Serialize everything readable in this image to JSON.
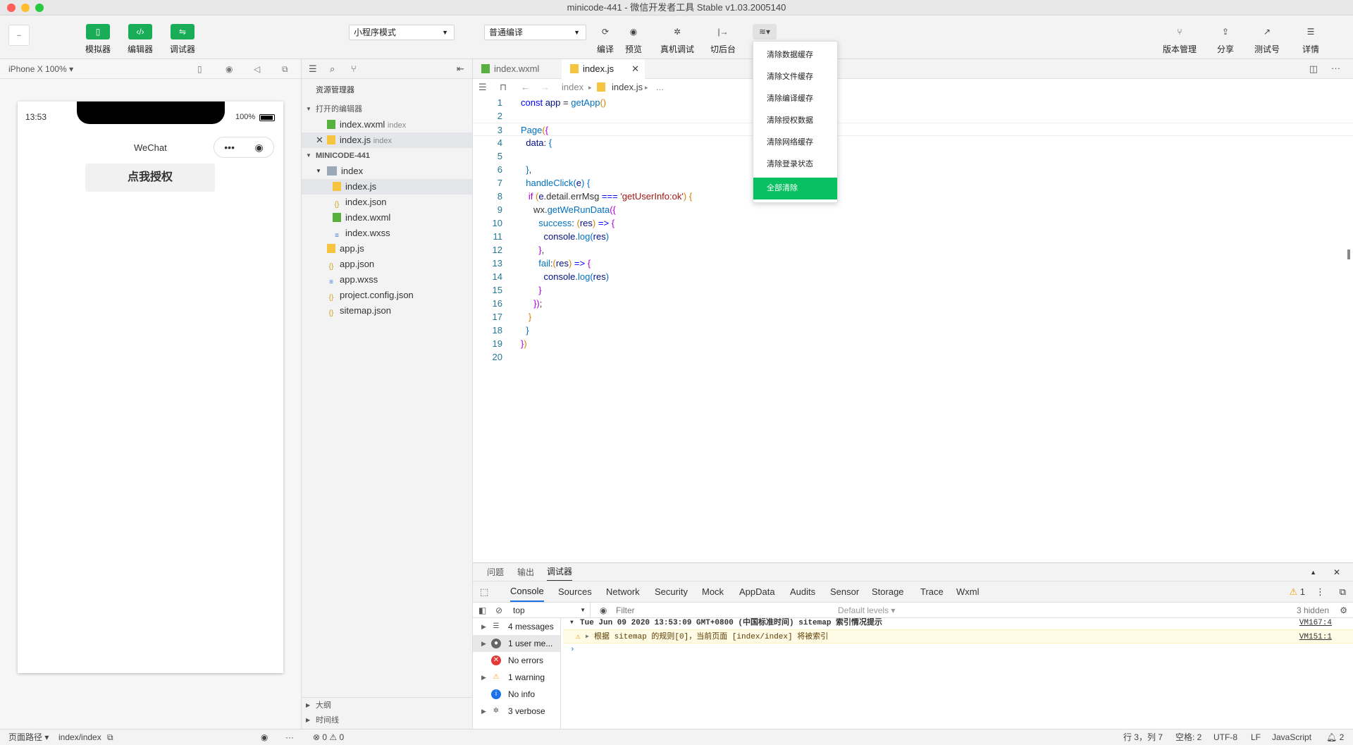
{
  "window": {
    "title": "minicode-441 - 微信开发者工具 Stable v1.03.2005140"
  },
  "toolbar": {
    "simulator": "模拟器",
    "editor": "编辑器",
    "debugger": "调试器",
    "mode_select": "小程序模式",
    "compile_select": "普通编译",
    "compile": "编译",
    "preview": "预览",
    "real_debug": "真机调试",
    "background": "切后台",
    "version": "版本管理",
    "share": "分享",
    "test_account": "测试号",
    "details": "详情"
  },
  "simulator": {
    "device": "iPhone X 100% ▾",
    "time": "13:53",
    "battery": "100%",
    "nav_title": "WeChat",
    "button_label": "点我授权"
  },
  "explorer": {
    "title": "资源管理器",
    "open_editors": "打开的编辑器",
    "open_files": [
      {
        "name": "index.wxml",
        "hint": "index"
      },
      {
        "name": "index.js",
        "hint": "index"
      }
    ],
    "project": "MINICODE-441",
    "tree": [
      "index",
      "index.js",
      "index.json",
      "index.wxml",
      "index.wxss",
      "app.js",
      "app.json",
      "app.wxss",
      "project.config.json",
      "sitemap.json"
    ],
    "outline": "大纲",
    "timeline": "时间线"
  },
  "editor": {
    "tabs": [
      "index.wxml",
      "index.js"
    ],
    "breadcrumb": [
      "index",
      "index.js",
      "..."
    ],
    "lines": [
      "1",
      "2",
      "3",
      "4",
      "5",
      "6",
      "7",
      "8",
      "9",
      "10",
      "11",
      "12",
      "13",
      "14",
      "15",
      "16",
      "17",
      "18",
      "19",
      "20"
    ]
  },
  "dropdown": {
    "items": [
      "清除数据缓存",
      "清除文件缓存",
      "清除编译缓存",
      "清除授权数据",
      "清除网络缓存",
      "清除登录状态"
    ],
    "primary": "全部清除"
  },
  "devtools": {
    "panels": [
      "问题",
      "输出",
      "调试器"
    ],
    "tabs": [
      "Console",
      "Sources",
      "Network",
      "Security",
      "Mock",
      "AppData",
      "Audits",
      "Sensor",
      "Storage",
      "Trace",
      "Wxml"
    ],
    "warn_count": "1",
    "context": "top",
    "filter_placeholder": "Filter",
    "levels": "Default levels ▾",
    "hidden": "3 hidden",
    "sidebar": [
      "4 messages",
      "1 user me...",
      "No errors",
      "1 warning",
      "No info",
      "3 verbose"
    ],
    "log1": "Tue Jun 09 2020 13:53:09 GMT+0800 (中国标准时间) sitemap 索引情况提示",
    "log1_src": "VM167:4",
    "log2": "根据 sitemap 的规则[0]，当前页面 [index/index] 将被索引",
    "log2_src": "VM151:1"
  },
  "statusbar": {
    "page_path_label": "页面路径 ▾",
    "page_path": "index/index",
    "errors": "0",
    "warnings": "0",
    "position": "行 3，列 7",
    "spaces": "空格: 2",
    "encoding": "UTF-8",
    "eol": "LF",
    "language": "JavaScript",
    "notifications": "2"
  },
  "colors": {
    "accent": "#1aad57",
    "primary_green": "#07c160"
  }
}
